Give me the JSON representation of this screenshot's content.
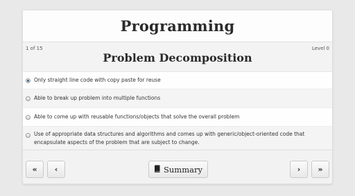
{
  "header": {
    "title": "Programming"
  },
  "subheader": {
    "counter": "1 of 15",
    "level": "Level 0",
    "title": "Problem Decomposition"
  },
  "options": [
    {
      "label": "Only straight line code with copy paste for reuse",
      "selected": true
    },
    {
      "label": "Able to break up problem into multiple functions",
      "selected": false
    },
    {
      "label": "Able to come up with reusable functions/objects that solve the overall problem",
      "selected": false
    },
    {
      "label": "Use of appropriate data structures and algorithms and comes up with generic/object-oriented code that encapsulate aspects of the problem that are subject to change.",
      "selected": false
    }
  ],
  "footer": {
    "first_icon": "«",
    "prev_icon": "‹",
    "next_icon": "›",
    "last_icon": "»",
    "summary_label": "Summary",
    "summary_icon": "book-icon"
  },
  "colors": {
    "radio_selected": "#2d5f98",
    "background": "#e9e9e9"
  }
}
